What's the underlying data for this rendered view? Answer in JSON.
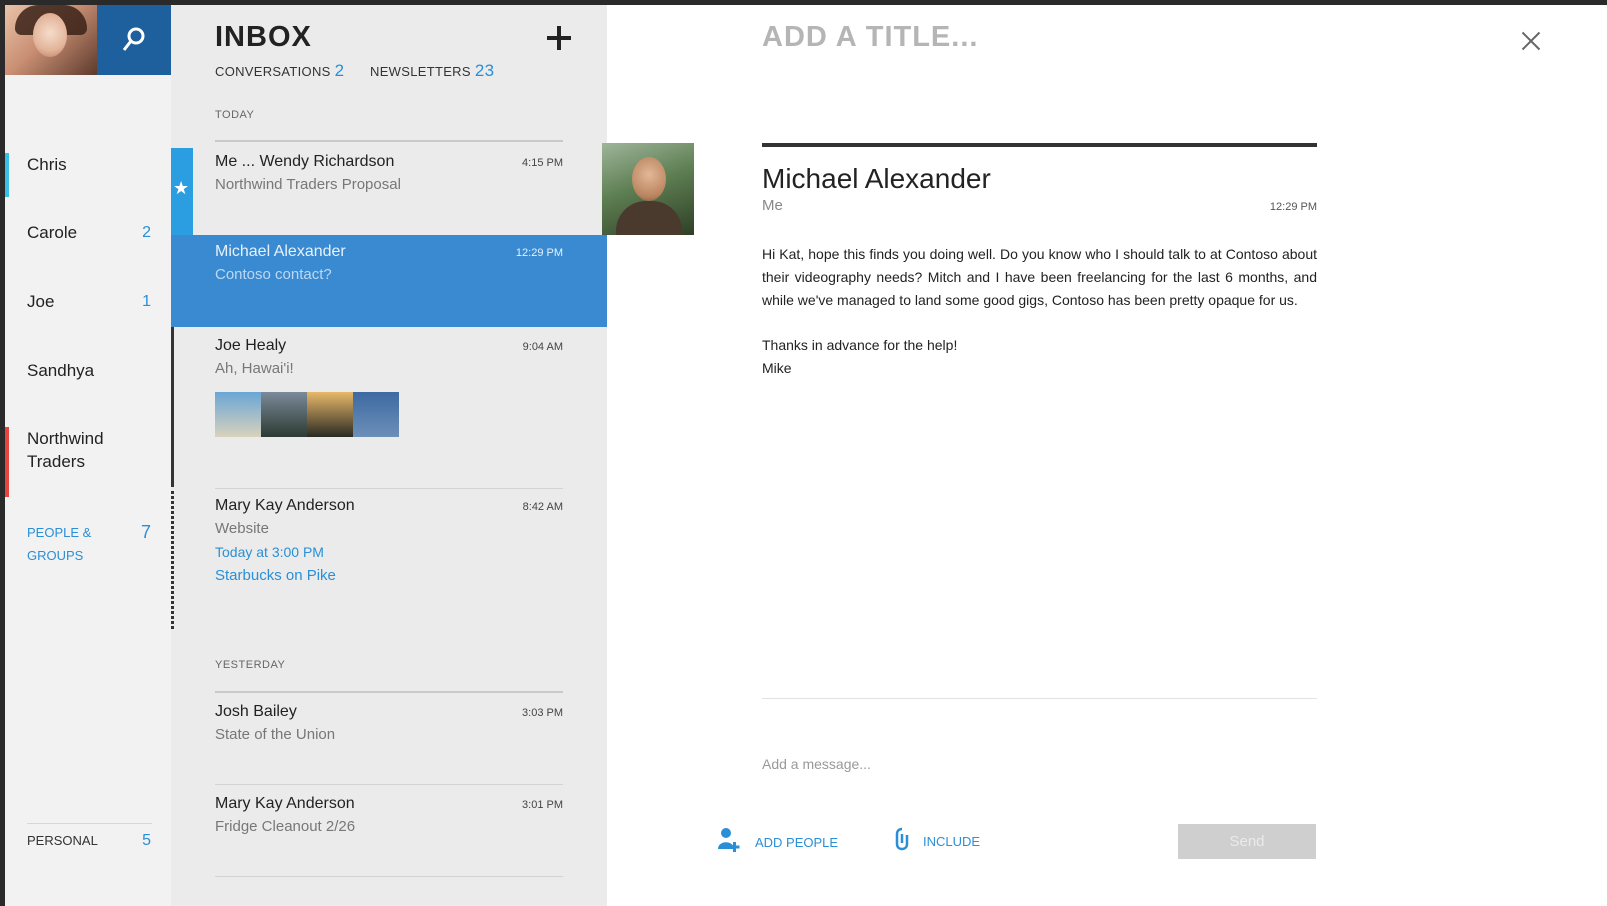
{
  "sidebar": {
    "search_icon": "search-icon",
    "items": [
      {
        "label": "Chris",
        "count": "",
        "accent": "#39c0e8"
      },
      {
        "label": "Carole",
        "count": "2",
        "accent": ""
      },
      {
        "label": "Joe",
        "count": "1",
        "accent": ""
      },
      {
        "label": "Sandhya",
        "count": "",
        "accent": ""
      },
      {
        "label": "Northwind Traders",
        "count": "",
        "accent": "#e8453c"
      },
      {
        "label": "PEOPLE & GROUPS",
        "count": "7",
        "accent": ""
      },
      {
        "label": "PERSONAL",
        "count": "5",
        "accent": ""
      }
    ]
  },
  "inbox": {
    "title": "INBOX",
    "tabs": [
      {
        "label": "CONVERSATIONS",
        "count": "2"
      },
      {
        "label": "NEWSLETTERS",
        "count": "23"
      }
    ],
    "sections": {
      "today": "TODAY",
      "yesterday": "YESTERDAY"
    },
    "messages": [
      {
        "from": "Me ... Wendy Richardson",
        "subject": "Northwind Traders Proposal",
        "time": "4:15 PM",
        "starred": true
      },
      {
        "from": "Michael Alexander",
        "subject": "Contoso contact?",
        "time": "12:29 PM",
        "selected": true
      },
      {
        "from": "Joe Healy",
        "subject": "Ah, Hawai'i!",
        "time": "9:04 AM"
      },
      {
        "from": "Mary Kay Anderson",
        "subject": "Website",
        "time": "8:42 AM",
        "line1": "Today at 3:00 PM",
        "line2": "Starbucks on Pike"
      },
      {
        "from": "Josh Bailey",
        "subject": "State of the Union",
        "time": "3:03 PM"
      },
      {
        "from": "Mary Kay Anderson",
        "subject": "Fridge Cleanout 2/26",
        "time": "3:01 PM"
      }
    ]
  },
  "reading": {
    "title_placeholder": "ADD A TITLE...",
    "sender": "Michael Alexander",
    "recipient": "Me",
    "time": "12:29 PM",
    "body_p1": "Hi Kat, hope this finds you doing well.  Do you know who I should talk to at Contoso about their videography needs?  Mitch and I have been freelancing for the last 6 months, and while we've managed to land some good gigs, Contoso has been pretty opaque for us.",
    "body_p2a": "Thanks in advance for the help!",
    "body_p2b": "Mike",
    "reply_placeholder": "Add a message...",
    "add_people": "ADD PEOPLE",
    "include": "INCLUDE",
    "send": "Send"
  },
  "colors": {
    "accent": "#2a8fd6",
    "selected_row": "#3a8ad1",
    "search_tile": "#1e5f9e"
  }
}
